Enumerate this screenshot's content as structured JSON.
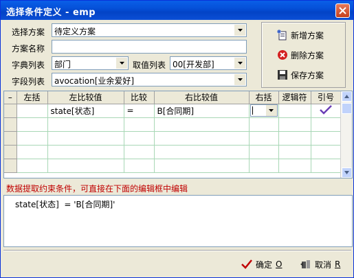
{
  "window": {
    "title": "选择条件定义 - emp"
  },
  "form": {
    "scheme_label": "选择方案",
    "scheme_value": "待定义方案",
    "scheme_name_label": "方案名称",
    "scheme_name_value": "",
    "dict_label": "字典列表",
    "dict_value": "部门",
    "value_list_label": "取值列表",
    "value_list_value": "00[开发部]",
    "field_label": "字段列表",
    "field_value": "avocation[业余爱好]"
  },
  "actions": {
    "add": "新增方案",
    "delete": "删除方案",
    "save": "保存方案"
  },
  "grid": {
    "columns": [
      "",
      "左括",
      "左比较值",
      "比较",
      "右比较值",
      "右括",
      "逻辑符",
      "引号"
    ],
    "rows": [
      {
        "lparen": "",
        "left": "state[状态]",
        "op": "=",
        "right": "B[合同期]",
        "rparen": "",
        "logic": "",
        "quote": "checked"
      },
      {
        "lparen": "",
        "left": "",
        "op": "",
        "right": "",
        "rparen": "",
        "logic": "",
        "quote": ""
      },
      {
        "lparen": "",
        "left": "",
        "op": "",
        "right": "",
        "rparen": "",
        "logic": "",
        "quote": ""
      },
      {
        "lparen": "",
        "left": "",
        "op": "",
        "right": "",
        "rparen": "",
        "logic": "",
        "quote": ""
      },
      {
        "lparen": "",
        "left": "",
        "op": "",
        "right": "",
        "rparen": "",
        "logic": "",
        "quote": ""
      }
    ]
  },
  "hint": "数据提取约束条件，可直接在下面的编辑框中编辑",
  "editor": {
    "text": "state[状态]  = 'B[合同期]'"
  },
  "footer": {
    "ok_label": "确定",
    "ok_key": "O",
    "cancel_label": "取消",
    "cancel_key": "R"
  },
  "colors": {
    "titlebar": "#0550d8",
    "hint": "#c00000",
    "check": "#6a3fb5"
  },
  "icons": [
    "close-icon",
    "new-scheme-icon",
    "delete-icon",
    "save-icon",
    "check-icon",
    "cancel-icon",
    "chevron-down-icon"
  ]
}
